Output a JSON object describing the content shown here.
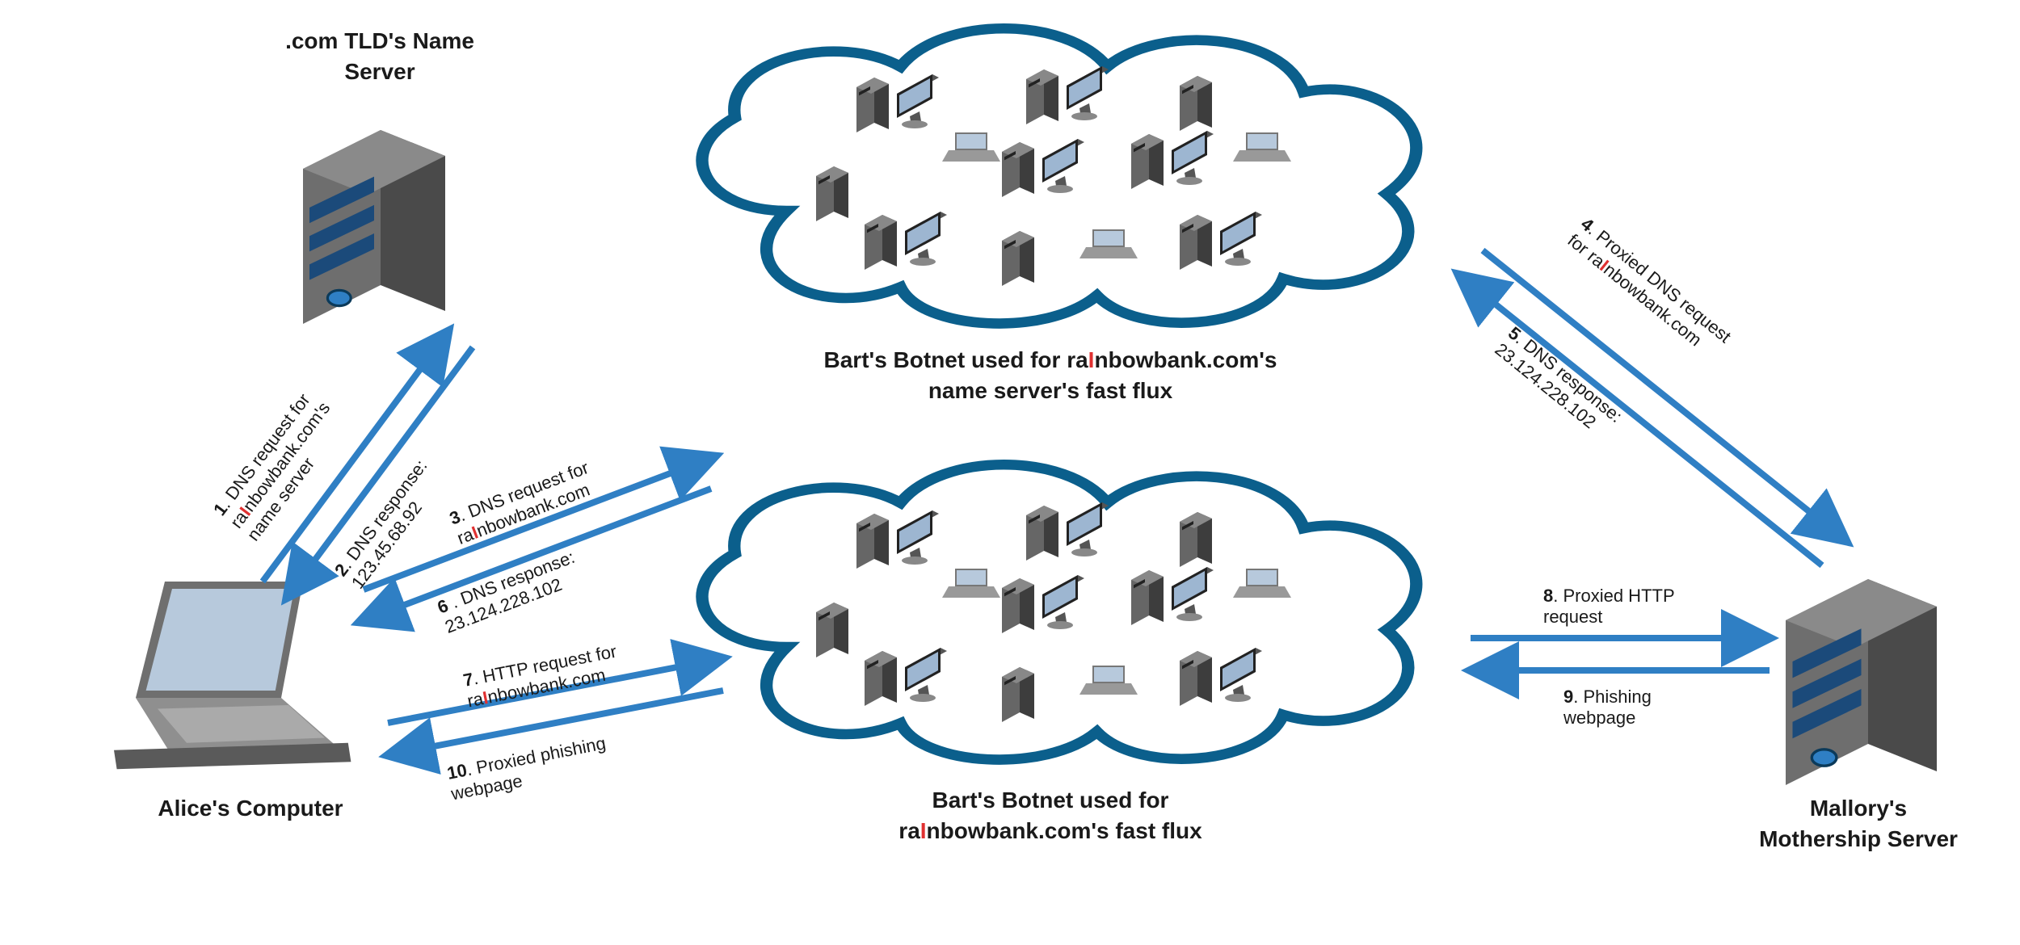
{
  "colors": {
    "arrow": "#2f7fc4",
    "cloud": "#0b5f8c",
    "server": "#555",
    "screen": "#a8bcd4",
    "laptop": "#888"
  },
  "nodes": {
    "tld": {
      "label1": ".com TLD's Name",
      "label2": "Server"
    },
    "alice": {
      "label": "Alice's Computer"
    },
    "mallory": {
      "label1": "Mallory's",
      "label2": "Mothership Server"
    },
    "botnet_top": {
      "line1": "Bart's Botnet used for ra",
      "hi1": "I",
      "line1b": "nbowbank.com's",
      "line2": "name server's fast flux"
    },
    "botnet_bot": {
      "line1": "Bart's Botnet used for",
      "line2a": "ra",
      "hi2": "I",
      "line2b": "nbowbank.com's fast flux"
    }
  },
  "msgs": {
    "m1": {
      "n": "1",
      "a": ". DNS request for",
      "b1": "ra",
      "hi": "I",
      "b2": "nbowbank.com's",
      "c": "name server"
    },
    "m2": {
      "n": "2",
      "a": ". DNS response:",
      "b": "123.45.68.92"
    },
    "m3": {
      "n": "3",
      "a": ". DNS request for",
      "b1": "ra",
      "hi": "I",
      "b2": "nbowbank.com"
    },
    "m6": {
      "n": "6",
      "a": " . DNS response:",
      "b": "23.124.228.102"
    },
    "m7": {
      "n": "7",
      "a": ". HTTP request for",
      "b1": "ra",
      "hi": "I",
      "b2": "nbowbank.com"
    },
    "m10": {
      "n": "10",
      "a": ". Proxied phishing",
      "b": "webpage"
    },
    "m4": {
      "n": "4",
      "a": ". Proxied DNS request",
      "b1": "for ra",
      "hi": "I",
      "b2": "nbowbank.com"
    },
    "m5": {
      "n": "5",
      "a": ". DNS response:",
      "b": "23.124.228.102"
    },
    "m8": {
      "n": "8",
      "a": ". Proxied HTTP",
      "b": "request"
    },
    "m9": {
      "n": "9",
      "a": ". Phishing",
      "b": "webpage"
    }
  }
}
